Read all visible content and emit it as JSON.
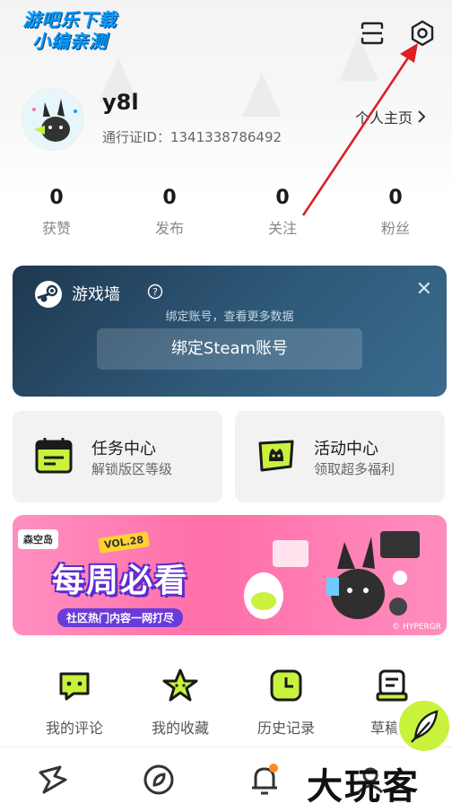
{
  "watermark_top": {
    "line1": "游吧乐下载",
    "line2": "小编亲测"
  },
  "header": {
    "scan_icon": "scan-icon",
    "settings_icon": "settings-hexagon-icon"
  },
  "profile": {
    "username": "y8l",
    "passport": "通行证ID：1341338786492",
    "homepage_label": "个人主页"
  },
  "stats": [
    {
      "value": "0",
      "label": "获赞"
    },
    {
      "value": "0",
      "label": "发布"
    },
    {
      "value": "0",
      "label": "关注"
    },
    {
      "value": "0",
      "label": "粉丝"
    }
  ],
  "steam_card": {
    "title": "游戏墙",
    "subtitle": "绑定账号，查看更多数据",
    "bind_button": "绑定Steam账号"
  },
  "features": [
    {
      "title": "任务中心",
      "subtitle": "解锁版区等级",
      "icon": "calendar-task-icon"
    },
    {
      "title": "活动中心",
      "subtitle": "领取超多福利",
      "icon": "activity-flag-icon"
    }
  ],
  "banner": {
    "tag": "森空岛",
    "vol": "VOL.28",
    "title": "每周必看",
    "subtitle": "社区热门内容一网打尽",
    "copyright": "© HYPERGR"
  },
  "shortcuts": [
    {
      "label": "我的评论",
      "icon": "comment-icon"
    },
    {
      "label": "我的收藏",
      "icon": "star-icon"
    },
    {
      "label": "历史记录",
      "icon": "clock-icon"
    },
    {
      "label": "草稿箱",
      "icon": "draft-icon"
    }
  ],
  "bottom_nav": [
    {
      "icon": "home-logo-icon"
    },
    {
      "icon": "compass-icon"
    },
    {
      "icon": "bell-icon"
    },
    {
      "icon": "profile-icon"
    }
  ],
  "watermark_bottom": "大玩客",
  "colors": {
    "accent": "#c8f23c",
    "steam_bg": "#2f5a7a",
    "banner_bg": "#ff6fa8",
    "arrow": "#e02020"
  }
}
